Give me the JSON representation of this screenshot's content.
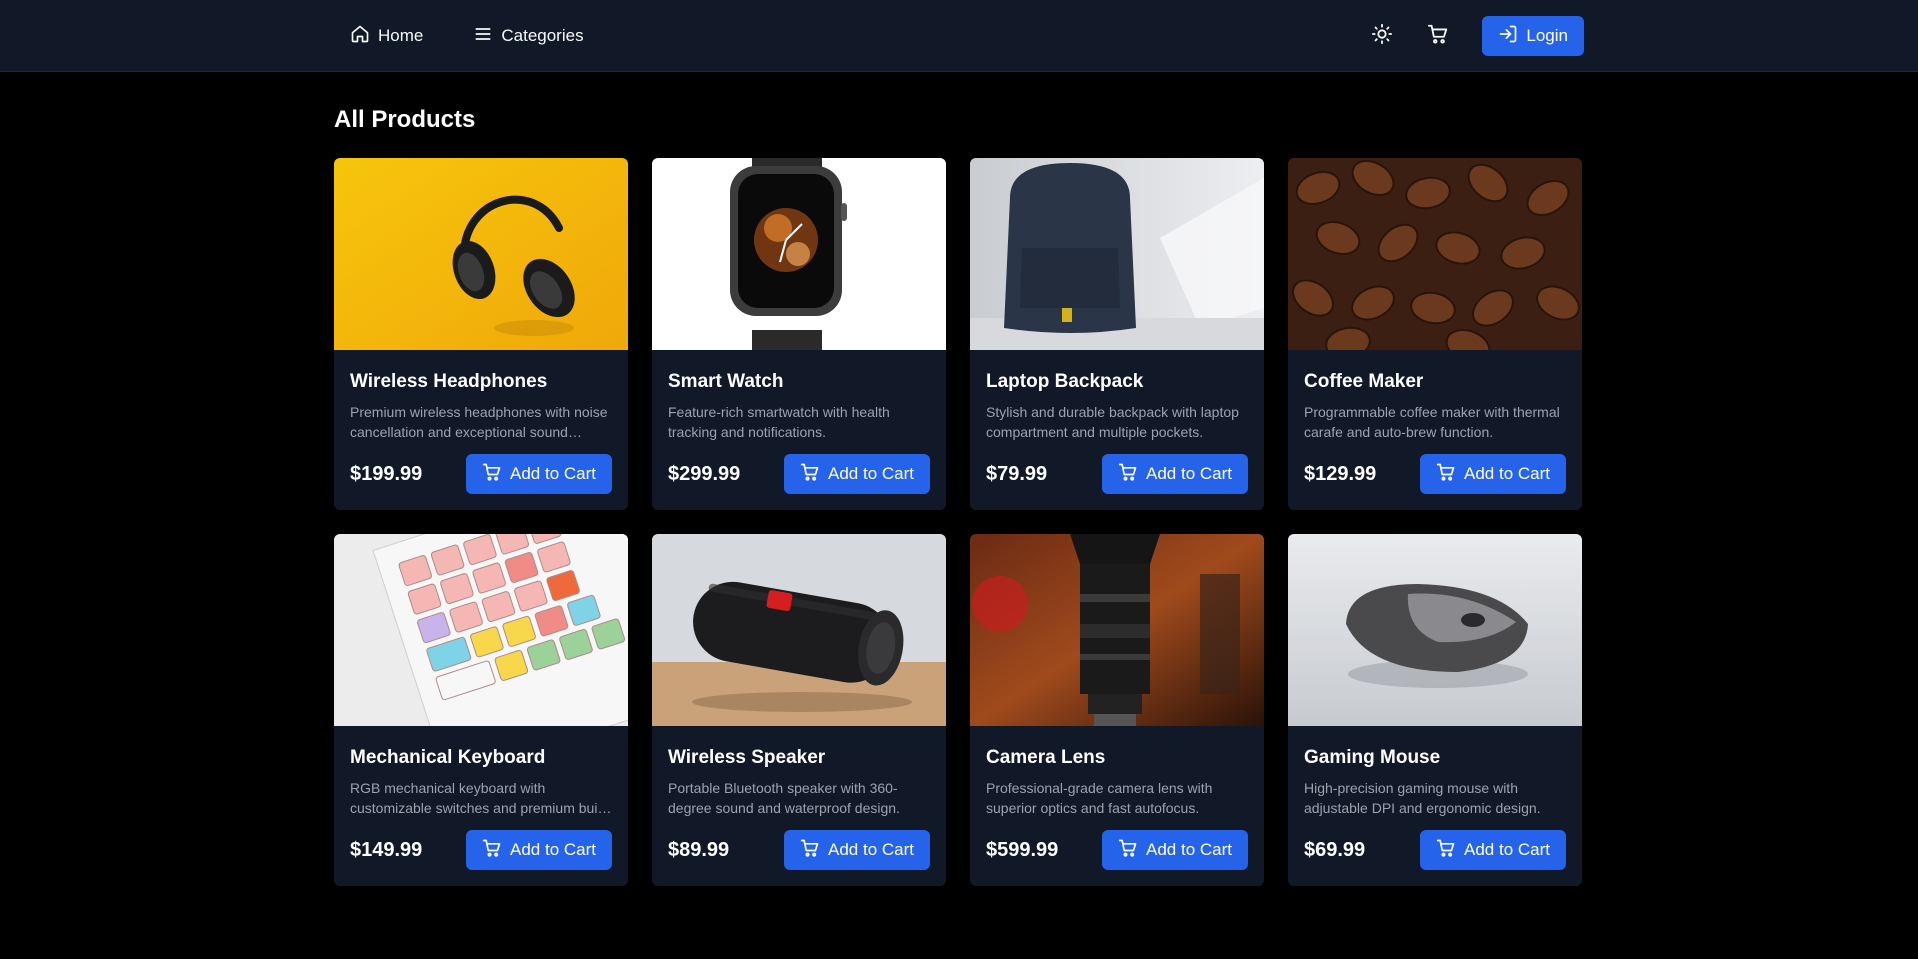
{
  "nav": {
    "home_label": "Home",
    "categories_label": "Categories",
    "login_label": "Login",
    "icons": {
      "home": "home-icon",
      "categories": "menu-icon",
      "theme": "sun-icon",
      "cart": "cart-icon",
      "login": "login-icon"
    }
  },
  "page": {
    "title": "All Products"
  },
  "colors": {
    "accent": "#2563eb",
    "nav_bg": "#111827",
    "card_bg": "#111827",
    "page_bg": "#000000",
    "muted_text": "#9ca3af"
  },
  "products": [
    {
      "name": "Wireless Headphones",
      "description": "Premium wireless headphones with noise cancellation and exceptional sound quality.",
      "price": "$199.99",
      "button": "Add to Cart",
      "image": "headphones"
    },
    {
      "name": "Smart Watch",
      "description": "Feature-rich smartwatch with health tracking and notifications.",
      "price": "$299.99",
      "button": "Add to Cart",
      "image": "watch"
    },
    {
      "name": "Laptop Backpack",
      "description": "Stylish and durable backpack with laptop compartment and multiple pockets.",
      "price": "$79.99",
      "button": "Add to Cart",
      "image": "backpack"
    },
    {
      "name": "Coffee Maker",
      "description": "Programmable coffee maker with thermal carafe and auto-brew function.",
      "price": "$129.99",
      "button": "Add to Cart",
      "image": "coffee"
    },
    {
      "name": "Mechanical Keyboard",
      "description": "RGB mechanical keyboard with customizable switches and premium build quality.",
      "price": "$149.99",
      "button": "Add to Cart",
      "image": "keyboard"
    },
    {
      "name": "Wireless Speaker",
      "description": "Portable Bluetooth speaker with 360-degree sound and waterproof design.",
      "price": "$89.99",
      "button": "Add to Cart",
      "image": "speaker"
    },
    {
      "name": "Camera Lens",
      "description": "Professional-grade camera lens with superior optics and fast autofocus.",
      "price": "$599.99",
      "button": "Add to Cart",
      "image": "lens"
    },
    {
      "name": "Gaming Mouse",
      "description": "High-precision gaming mouse with adjustable DPI and ergonomic design.",
      "price": "$69.99",
      "button": "Add to Cart",
      "image": "mouse"
    }
  ]
}
